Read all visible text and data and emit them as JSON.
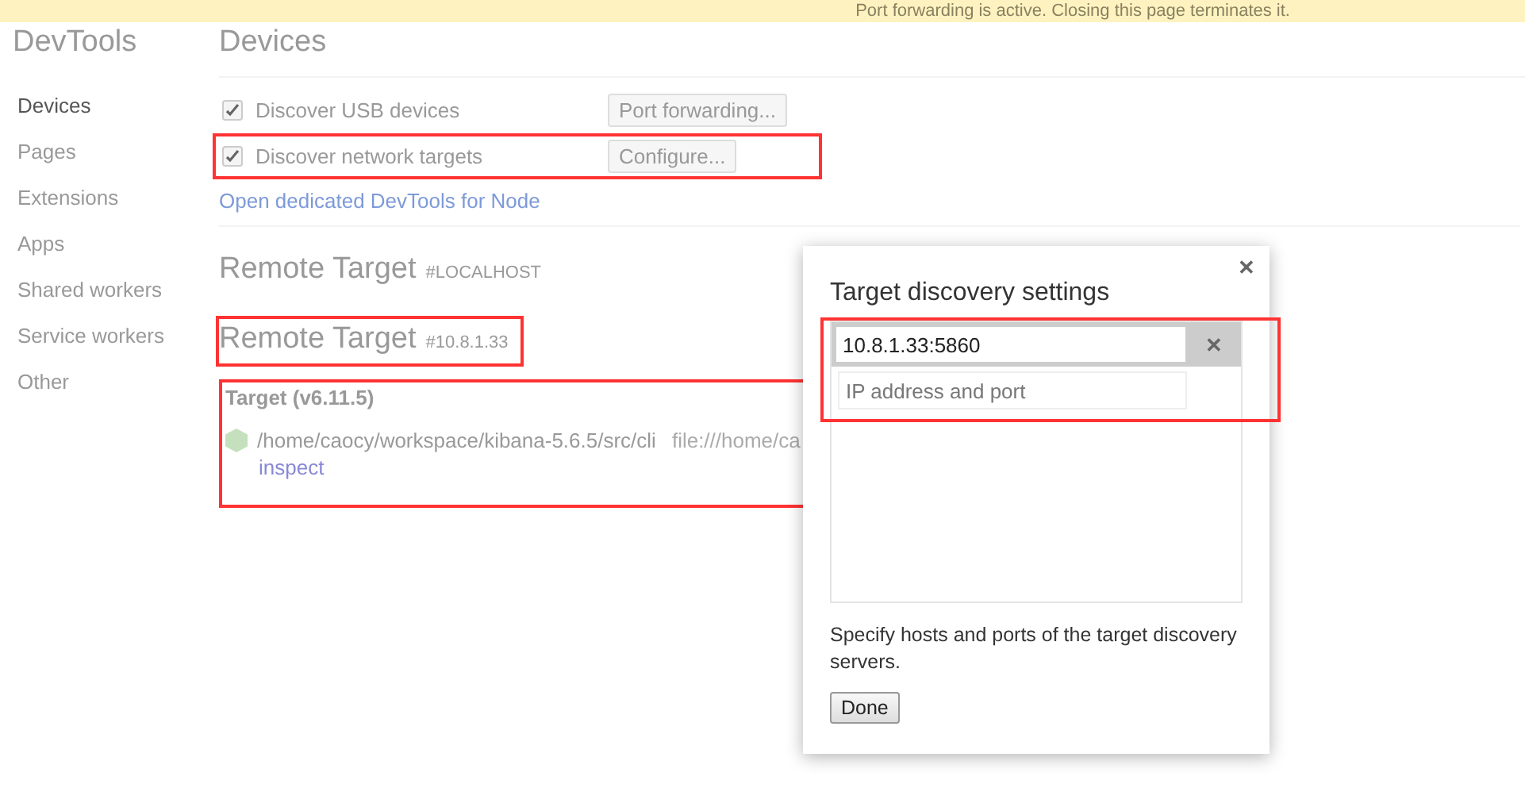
{
  "banner": {
    "text": "Port forwarding is active. Closing this page terminates it."
  },
  "sidebar": {
    "title": "DevTools",
    "items": [
      {
        "label": "Devices",
        "selected": true
      },
      {
        "label": "Pages",
        "selected": false
      },
      {
        "label": "Extensions",
        "selected": false
      },
      {
        "label": "Apps",
        "selected": false
      },
      {
        "label": "Shared workers",
        "selected": false
      },
      {
        "label": "Service workers",
        "selected": false
      },
      {
        "label": "Other",
        "selected": false
      }
    ]
  },
  "devices": {
    "title": "Devices",
    "options": [
      {
        "label": "Discover USB devices",
        "checked": true,
        "button": "Port forwarding...",
        "highlighted": false
      },
      {
        "label": "Discover network targets",
        "checked": true,
        "button": "Configure...",
        "highlighted": true
      }
    ],
    "link": "Open dedicated DevTools for Node"
  },
  "remote_targets": [
    {
      "title": "Remote Target",
      "host": "#LOCALHOST",
      "highlighted": false
    },
    {
      "title": "Remote Target",
      "host": "#10.8.1.33",
      "highlighted": true,
      "target": {
        "name": "Target (v6.11.5)",
        "path": "/home/caocy/workspace/kibana-5.6.5/src/cli",
        "url": "file:///home/ca",
        "action": "inspect",
        "highlighted": true
      }
    }
  ],
  "dialog": {
    "close": "✕",
    "title": "Target discovery settings",
    "highlighted": true,
    "entries": [
      {
        "value": "10.8.1.33:5860",
        "remove": "✕"
      }
    ],
    "new_entry": {
      "placeholder": "IP address and port"
    },
    "hint": "Specify hosts and ports of the target discovery servers.",
    "button": "Done"
  }
}
